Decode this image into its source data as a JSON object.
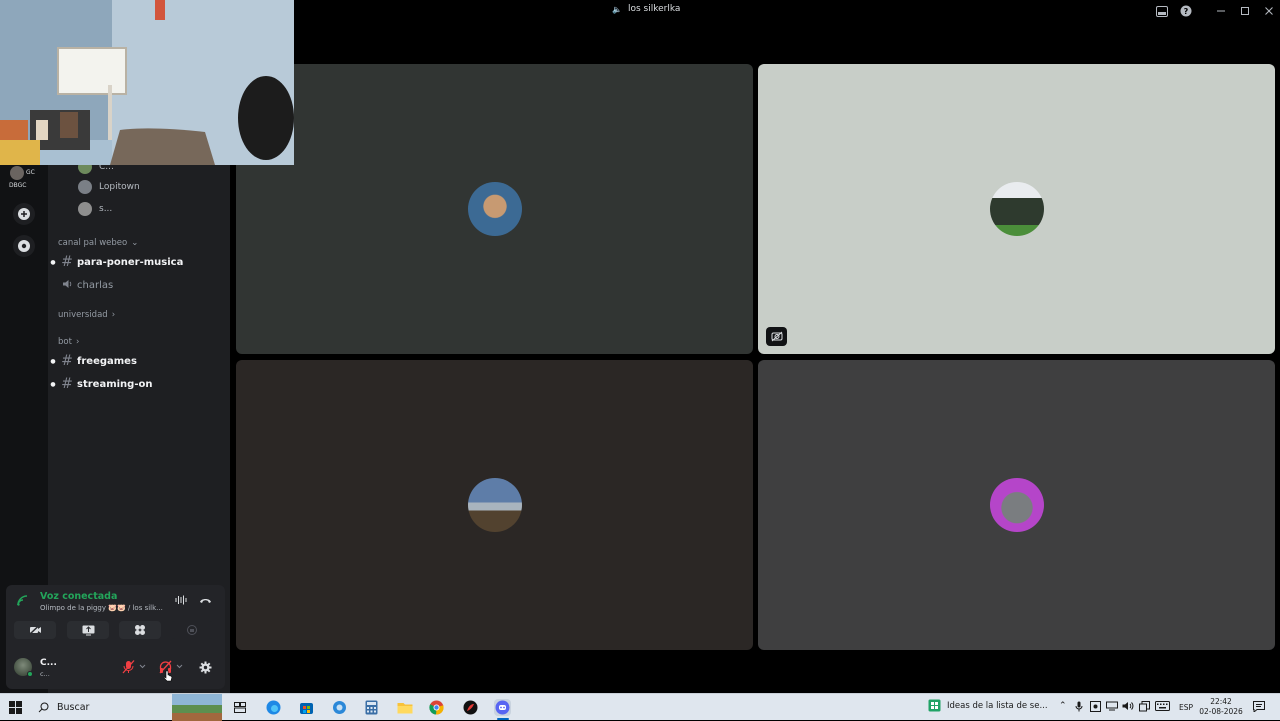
{
  "window": {
    "title": "los silkerlka"
  },
  "sidebar": {
    "rail_label": "DBGC",
    "voice_users": [
      {
        "name": "C..."
      },
      {
        "name": "Lopitown"
      },
      {
        "name": "s..."
      }
    ],
    "categories": [
      {
        "label": "canal pal webeo"
      },
      {
        "label": "universidad"
      },
      {
        "label": "bot"
      }
    ],
    "channels": [
      {
        "name": "para-poner-musica"
      },
      {
        "name": "charlas"
      },
      {
        "name": "freegames"
      },
      {
        "name": "streaming-on"
      }
    ]
  },
  "voice_panel": {
    "status": "Voz conectada",
    "subtitle": "Olimpo de la piggy 🐷🐷 / los silk...",
    "user_name": "C...",
    "user_tag": "c..."
  },
  "taskbar": {
    "search_placeholder": "Buscar",
    "active_window": "Ideas de la lista de se...",
    "language": "ESP",
    "time": "22:42",
    "date": "02-08-2026"
  },
  "colors": {
    "tile_1": "#313533",
    "tile_2": "#c8cec8",
    "tile_3": "#2b2725",
    "tile_4": "#3f3f40",
    "voice_green": "#23a55a",
    "mute_red": "#f23f43"
  }
}
